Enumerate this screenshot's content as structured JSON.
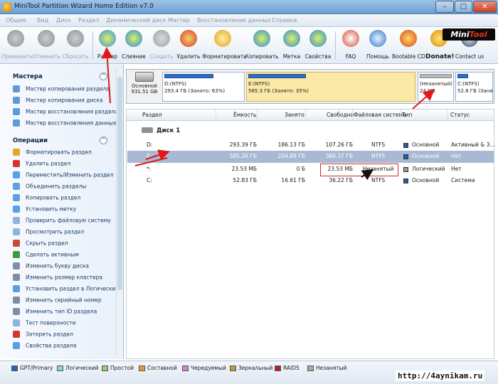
{
  "window": {
    "title": "MiniTool Partition Wizard Home Edition v7.0",
    "controls": [
      "–",
      "□",
      "✕"
    ]
  },
  "menu": [
    "Общие",
    "Вид",
    "Диск",
    "Раздел",
    "Динамический диск",
    "Мастер",
    "Восстановление данных",
    "Справка"
  ],
  "toolbar": {
    "buttons": [
      {
        "label": "Применить",
        "icon": "check-icon",
        "enabled": false
      },
      {
        "label": "Отменить",
        "icon": "undo-icon",
        "enabled": false
      },
      {
        "label": "Сбросить",
        "icon": "discard-icon",
        "enabled": false
      },
      {
        "label": "Размер",
        "icon": "resize-icon",
        "enabled": true
      },
      {
        "label": "Слияние",
        "icon": "merge-icon",
        "enabled": true
      },
      {
        "label": "Создать",
        "icon": "create-icon",
        "enabled": false
      },
      {
        "label": "Удалить",
        "icon": "delete-icon",
        "enabled": true
      },
      {
        "label": "Форматировать",
        "icon": "format-icon",
        "enabled": true
      },
      {
        "label": "Копировать",
        "icon": "copy-icon",
        "enabled": true
      },
      {
        "label": "Метка",
        "icon": "label-icon",
        "enabled": true
      },
      {
        "label": "Свойства",
        "icon": "properties-icon",
        "enabled": true
      },
      {
        "label": "FAQ",
        "icon": "faq-icon",
        "enabled": true
      },
      {
        "label": "Помощь",
        "icon": "help-icon",
        "enabled": true
      },
      {
        "label": "Bootable CD",
        "icon": "bootable-cd-icon",
        "enabled": true
      },
      {
        "label": "Donate!",
        "icon": "donate-icon",
        "enabled": true
      },
      {
        "label": "Contact us",
        "icon": "contact-icon",
        "enabled": true
      }
    ],
    "logo_text": "Mini",
    "logo_accent": "Tool"
  },
  "sidebar": {
    "wizards_title": "Мастера",
    "wizards": [
      "Мастер копирования раздела",
      "Мастер копирования диска",
      "Мастер восстановления раздела",
      "Мастер восстановления данных"
    ],
    "operations_title": "Операции",
    "operations": [
      "Форматировать раздел",
      "Удалить раздел",
      "Переместить/Изменить раздел",
      "Объединить разделы",
      "Копировать раздел",
      "Установить метку",
      "Проверить файловую систему",
      "Просмотреть раздел",
      "Скрыть раздел",
      "Сделать активным",
      "Изменить букву диска",
      "Изменить размер кластера",
      "Установить раздел в Логический",
      "Изменить серийный номер",
      "Изменить тип ID раздела",
      "Тест поверхности",
      "Затереть раздел",
      "Свойства раздела"
    ]
  },
  "disk_map": {
    "disk_type": "Основной",
    "disk_size": "931.51 GB",
    "segments": [
      {
        "line1": "D:(NTFS)",
        "line2": "293.4 ГБ (Занято: 63%)",
        "used": 0.63,
        "selected": false
      },
      {
        "line1": "E:(NTFS)",
        "line2": "585.3 ГБ (Занято: 35%)",
        "used": 0.35,
        "selected": true
      },
      {
        "line1": "(Незанятый)",
        "line2": "24 МБ",
        "used": 1.0,
        "selected": false
      },
      {
        "line1": "C:(NTFS)",
        "line2": "52.8 ГБ (Заня",
        "used": 0.31,
        "selected": false
      }
    ]
  },
  "table": {
    "columns": [
      "Раздел",
      "Ёмкость",
      "Занято",
      "Свободно",
      "Файловая система",
      "Тип",
      "Статус"
    ],
    "disk_label": "Диск 1",
    "rows": [
      {
        "partition": "D:",
        "capacity": "293.39 ГБ",
        "used": "186.13 ГБ",
        "free": "107.26 ГБ",
        "fs": "NTFS",
        "type": "Основной",
        "status": "Активный & З...",
        "type_color": "#1f5fae",
        "selected": false
      },
      {
        "partition": "E:",
        "capacity": "585.26 ГБ",
        "used": "204.89 ГБ",
        "free": "380.37 ГБ",
        "fs": "NTFS",
        "type": "Основной",
        "status": "Нет",
        "type_color": "#1f5fae",
        "selected": true
      },
      {
        "partition": "*:",
        "capacity": "23.53 МБ",
        "used": "0 Б",
        "free": "23.53 МБ",
        "fs": "Незанятый",
        "type": "Логический",
        "status": "Нет",
        "type_color": "#9a9a9a",
        "selected": false
      },
      {
        "partition": "C:",
        "capacity": "52.83 ГБ",
        "used": "16.61 ГБ",
        "free": "36.22 ГБ",
        "fs": "NTFS",
        "type": "Основной",
        "status": "Система",
        "type_color": "#1f5fae",
        "selected": false
      }
    ]
  },
  "legend": [
    {
      "label": "GPT/Primary",
      "color": "#2a63b5"
    },
    {
      "label": "Логический",
      "color": "#8fd0e8"
    },
    {
      "label": "Простой",
      "color": "#8ed27a"
    },
    {
      "label": "Составной",
      "color": "#e39a3a"
    },
    {
      "label": "Чередуемый",
      "color": "#d282d8"
    },
    {
      "label": "Зеркальный",
      "color": "#b5a23a"
    },
    {
      "label": "RAID5",
      "color": "#b0242a"
    },
    {
      "label": "Незанятый",
      "color": "#a8a8a8"
    }
  ],
  "watermark": "http://4aynikam.ru"
}
